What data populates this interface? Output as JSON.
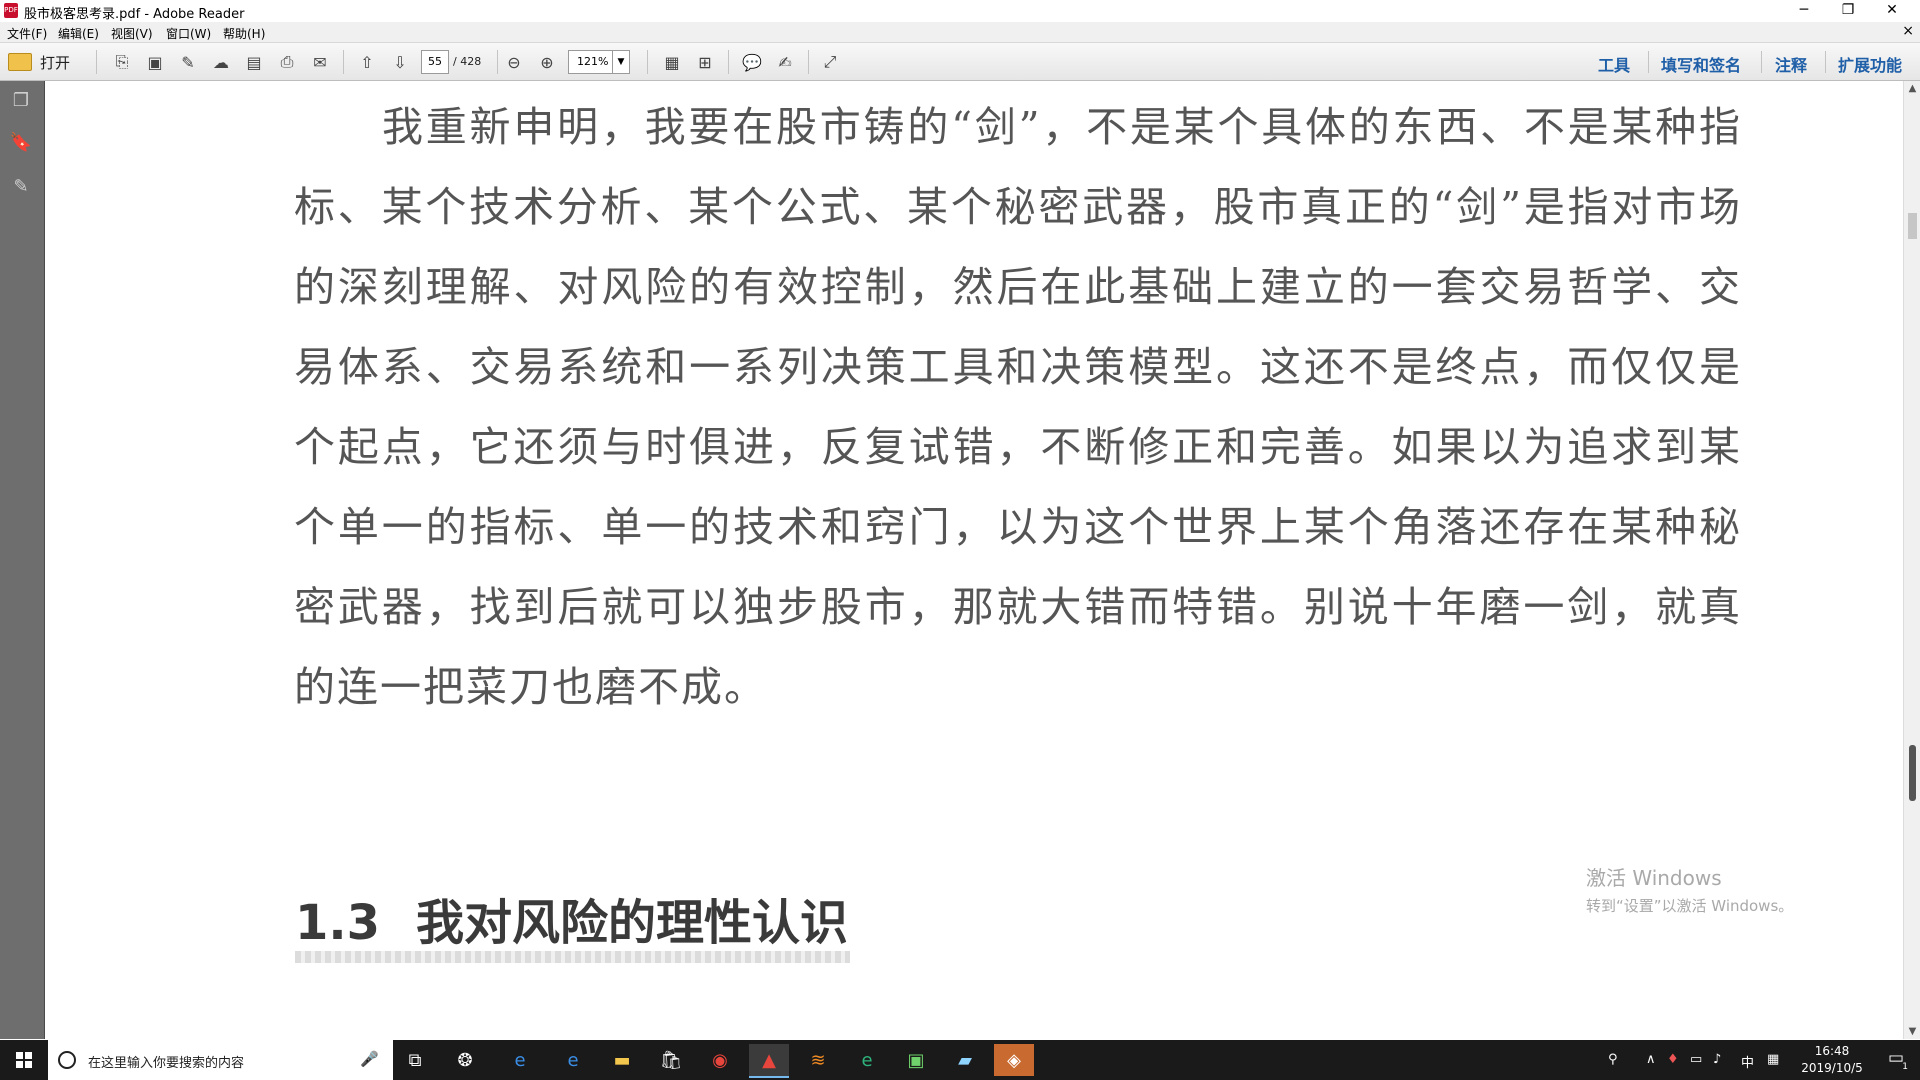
{
  "window": {
    "title": "股市极客思考录.pdf - Adobe Reader",
    "minimize": "─",
    "restore": "❐",
    "close": "✕",
    "app_icon": "PDF"
  },
  "menu": [
    "文件(F)",
    "编辑(E)",
    "视图(V)",
    "窗口(W)",
    "帮助(H)"
  ],
  "doc_close": "×",
  "toolbar": {
    "open_label": "打开",
    "page_current": "55",
    "page_total": "/ 428",
    "zoom": "121%",
    "right_buttons": [
      "工具",
      "填写和签名",
      "注释",
      "扩展功能"
    ]
  },
  "document": {
    "paragraph": "我重新申明，我要在股市铸的“剑”，不是某个具体的东西、不是某种指标、某个技术分析、某个公式、某个秘密武器，股市真正的“剑”是指对市场的深刻理解、对风险的有效控制，然后在此基础上建立的一套交易哲学、交易体系、交易系统和一系列决策工具和决策模型。这还不是终点，而仅仅是个起点，它还须与时俱进，反复试错，不断修正和完善。如果以为追求到某个单一的指标、单一的技术和窍门，以为这个世界上某个角落还存在某种秘密武器，找到后就可以独步股市，那就大错而特错。别说十年磨一剑，就真的连一把菜刀也磨不成。",
    "heading_number": "1.3",
    "heading_text": "我对风险的理性认识"
  },
  "watermark": {
    "line1": "激活 Windows",
    "line2": "转到“设置”以激活 Windows。"
  },
  "taskbar": {
    "search_placeholder": "在这里输入你要搜索的内容",
    "ime": "中",
    "time": "16:48",
    "date": "2019/10/5",
    "notification_count": "1"
  }
}
